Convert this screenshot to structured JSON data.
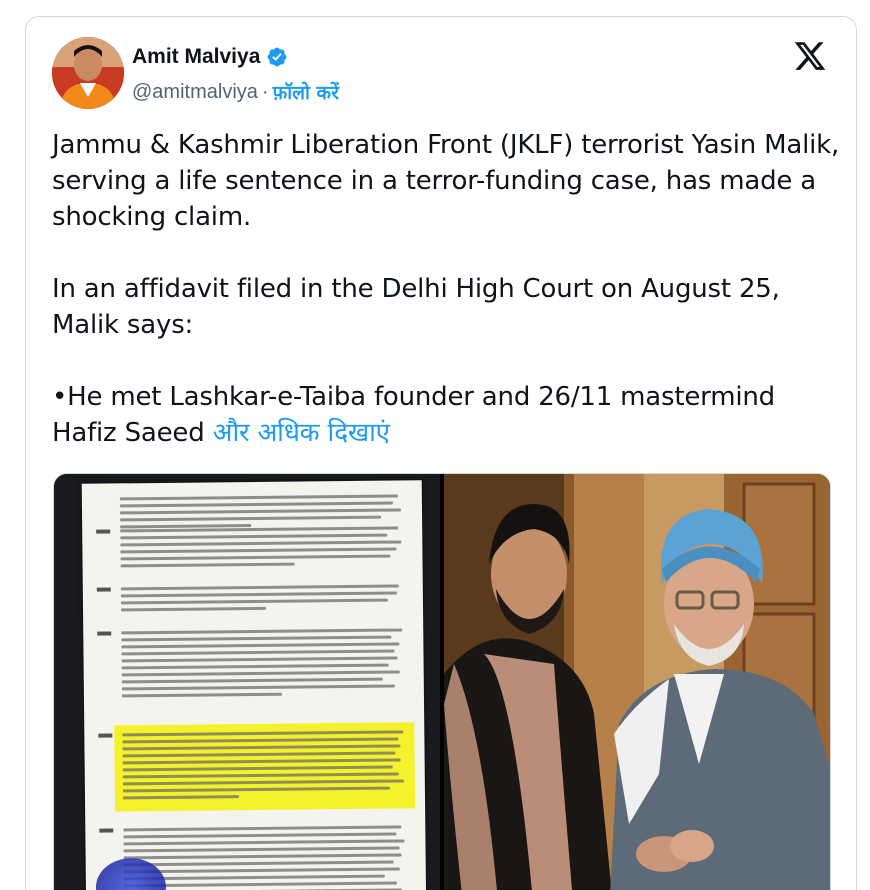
{
  "author": {
    "name": "Amit Malviya",
    "handle": "@amitmalviya",
    "separator": "·",
    "follow_label": "फ़ॉलो करें"
  },
  "icons": {
    "verified": "verified-badge-icon",
    "x_logo": "x-logo-icon"
  },
  "tweet": {
    "paragraph1": "Jammu & Kashmir Liberation Front (JKLF) terrorist Yasin Malik, serving a life sentence in a terror-funding case, has made a shocking claim.",
    "paragraph2": "In an affidavit filed in the Delhi High Court on August 25, Malik says:",
    "paragraph3": "•He met Lashkar-e-Taiba founder and 26/11 mastermind Hafiz Saeed",
    "show_more": "और अधिक दिखाएं"
  },
  "colors": {
    "accent": "#1d9bf0",
    "text": "#0f1419",
    "muted": "#536471",
    "verified": "#1d9bf0"
  }
}
